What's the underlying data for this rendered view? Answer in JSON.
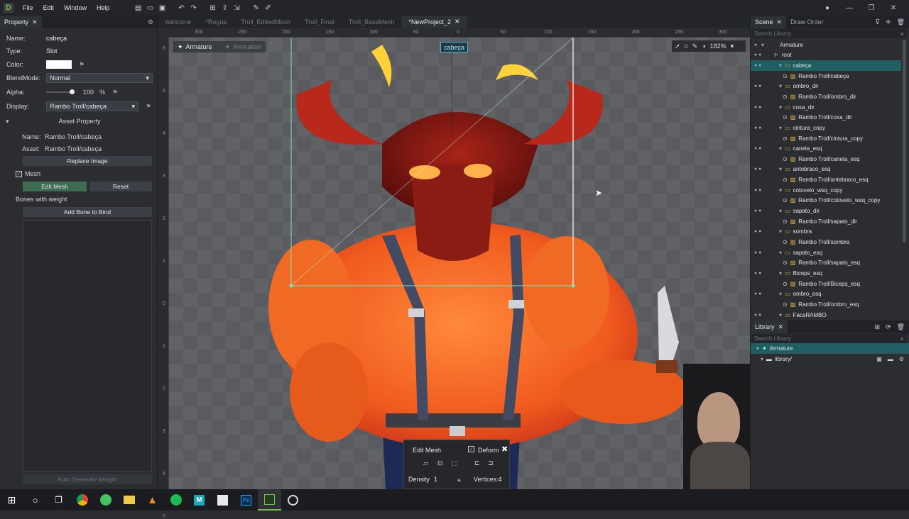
{
  "menubar": {
    "items": [
      "File",
      "Edit",
      "Window",
      "Help"
    ]
  },
  "property": {
    "tab": "Property",
    "name_label": "Name:",
    "name_value": "cabeça",
    "type_label": "Type:",
    "type_value": "Slot",
    "color_label": "Color:",
    "color_value": "#ffffff",
    "blend_label": "BlendMode:",
    "blend_value": "Normal",
    "alpha_label": "Alpha:",
    "alpha_value": "100",
    "alpha_unit": "%",
    "alpha_fraction": 1.0,
    "display_label": "Display:",
    "display_value": "Rambo Troll/cabeça",
    "asset_header": "Asset Property",
    "asset_name_label": "Name:",
    "asset_name_value": "Rambo Troll/cabeça",
    "asset_label": "Asset:",
    "asset_value": "Rambo Troll/cabeça",
    "replace_button": "Replace Image",
    "mesh_label": "Mesh",
    "edit_mesh_button": "Edit Mesh",
    "reset_button": "Reset",
    "bones_label": "Bones with weight",
    "add_bone_button": "Add Bone to Bind",
    "auto_weight_button": "Auto Generate Weight"
  },
  "doc_tabs": [
    "Welcome",
    "*Rogue",
    "Troll_EditedMesh",
    "Troll_Final",
    "Troll_BaseMesh",
    "*NewProject_2"
  ],
  "ruler_h": [
    "300",
    "250",
    "200",
    "150",
    "100",
    "50",
    "0",
    "50",
    "100",
    "150",
    "200",
    "250",
    "300"
  ],
  "ruler_v": [
    "6",
    "5",
    "4",
    "3",
    "2",
    "1",
    "0",
    "1",
    "2",
    "3",
    "4",
    "5"
  ],
  "canvas": {
    "mode_armature": "Armature",
    "mode_animation": "Animation",
    "slot_tag": "cabeça",
    "zoom": "182%",
    "mesh_panel": {
      "edit_mesh": "Edit Mesh",
      "deform": "Deform",
      "density_label": "Density",
      "density_value": "1",
      "vertices": "Vertices:4"
    }
  },
  "scene": {
    "tabs": [
      "Scene",
      "Draw Order"
    ],
    "search_placeholder": "Search Library",
    "armature": "Armature",
    "root": "root",
    "tree": [
      {
        "label": "cabeça",
        "kind": "slot"
      },
      {
        "label": "Rambo Troll/cabeça",
        "kind": "image"
      },
      {
        "label": "ombro_dir",
        "kind": "slot"
      },
      {
        "label": "Rambo Troll/ombro_dir",
        "kind": "image"
      },
      {
        "label": "coxa_dir",
        "kind": "slot"
      },
      {
        "label": "Rambo Troll/coxa_dir",
        "kind": "image"
      },
      {
        "label": "cintura_copy",
        "kind": "slot"
      },
      {
        "label": "Rambo Troll/cintura_copy",
        "kind": "image"
      },
      {
        "label": "canela_esq",
        "kind": "slot"
      },
      {
        "label": "Rambo Troll/canela_esq",
        "kind": "image"
      },
      {
        "label": "antebraco_esq",
        "kind": "slot"
      },
      {
        "label": "Rambo Troll/antebraco_esq",
        "kind": "image"
      },
      {
        "label": "cotovelo_wsq_copy",
        "kind": "slot"
      },
      {
        "label": "Rambo Troll/cotovelo_wsq_copy",
        "kind": "image"
      },
      {
        "label": "sapato_dir",
        "kind": "slot"
      },
      {
        "label": "Rambo Troll/sapato_dir",
        "kind": "image"
      },
      {
        "label": "sombra",
        "kind": "slot"
      },
      {
        "label": "Rambo Troll/sombra",
        "kind": "image"
      },
      {
        "label": "sapato_esq",
        "kind": "slot"
      },
      {
        "label": "Rambo Troll/sapato_esq",
        "kind": "image"
      },
      {
        "label": "Biceps_esq",
        "kind": "slot"
      },
      {
        "label": "Rambo Troll/Biceps_esq",
        "kind": "image"
      },
      {
        "label": "ombro_esq",
        "kind": "slot"
      },
      {
        "label": "Rambo Troll/ombro_esq",
        "kind": "image"
      },
      {
        "label": "FacaRAMBO",
        "kind": "slot"
      }
    ]
  },
  "library": {
    "tab": "Library",
    "search_placeholder": "Search Library",
    "armature": "Armature",
    "folder": "library/"
  },
  "colors": {
    "accent": "#1f5f61",
    "mesh_line": "#7fe0c8",
    "background": "#2b2d31"
  }
}
